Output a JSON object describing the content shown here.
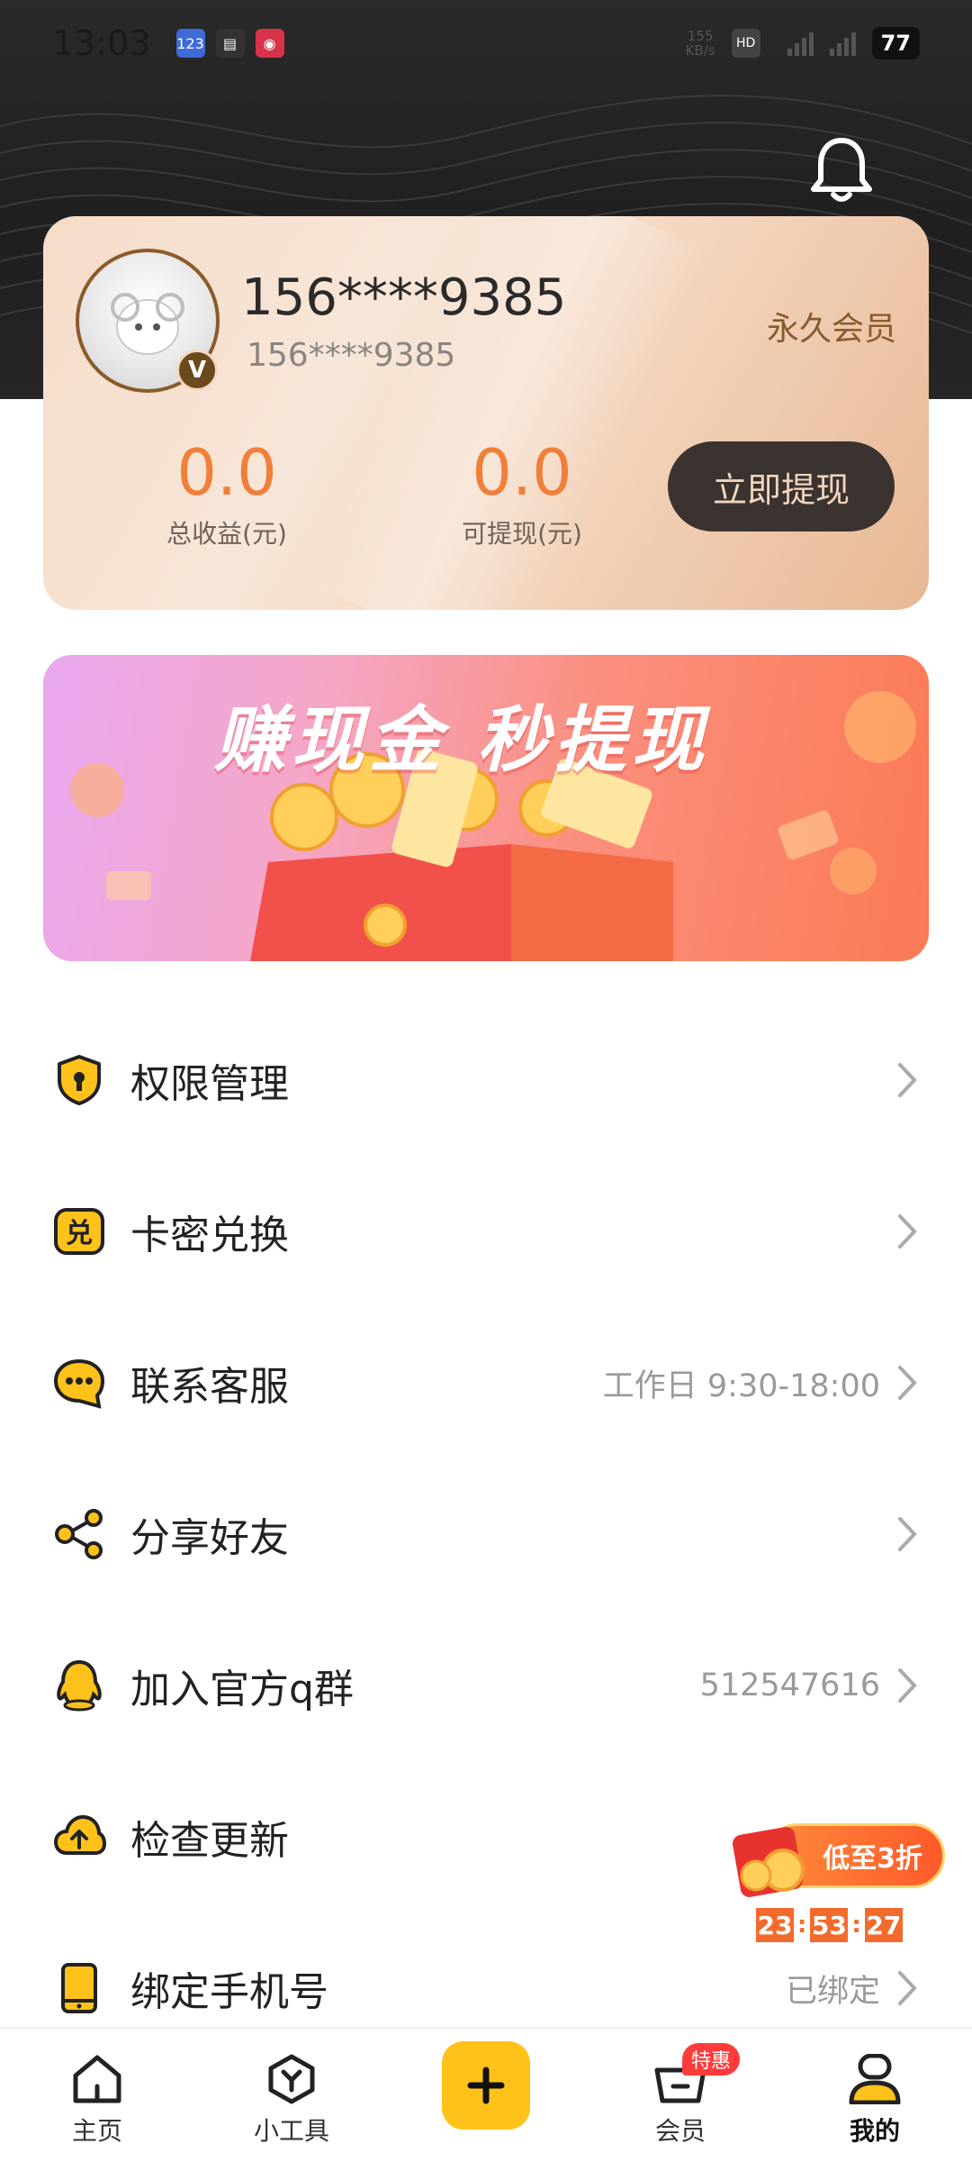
{
  "status_bar": {
    "time": "13:03",
    "net_speed_top": "155",
    "net_speed_unit": "KB/s",
    "battery": "77"
  },
  "card": {
    "phone": "156****9385",
    "phone_sub": "156****9385",
    "member_type": "永久会员",
    "total_income_value": "0.0",
    "total_income_label": "总收益(元)",
    "withdrawable_value": "0.0",
    "withdrawable_label": "可提现(元)",
    "withdraw_button": "立即提现"
  },
  "banner": {
    "title": "赚现金  秒提现"
  },
  "menu": [
    {
      "label": "权限管理",
      "value": ""
    },
    {
      "label": "卡密兑换",
      "value": ""
    },
    {
      "label": "联系客服",
      "value": "工作日 9:30-18:00"
    },
    {
      "label": "分享好友",
      "value": ""
    },
    {
      "label": "加入官方q群",
      "value": "512547616"
    },
    {
      "label": "检查更新",
      "value": ""
    },
    {
      "label": "绑定手机号",
      "value": "已绑定"
    }
  ],
  "promo": {
    "label": "低至3折",
    "hh": "23",
    "mm": "53",
    "ss": "27"
  },
  "tabbar": {
    "home": "主页",
    "tools": "小工具",
    "member": "会员",
    "member_badge": "特惠",
    "mine": "我的"
  },
  "colors": {
    "accent": "#ffc21a",
    "orange": "#f07f3a",
    "dark": "#3b3330"
  }
}
